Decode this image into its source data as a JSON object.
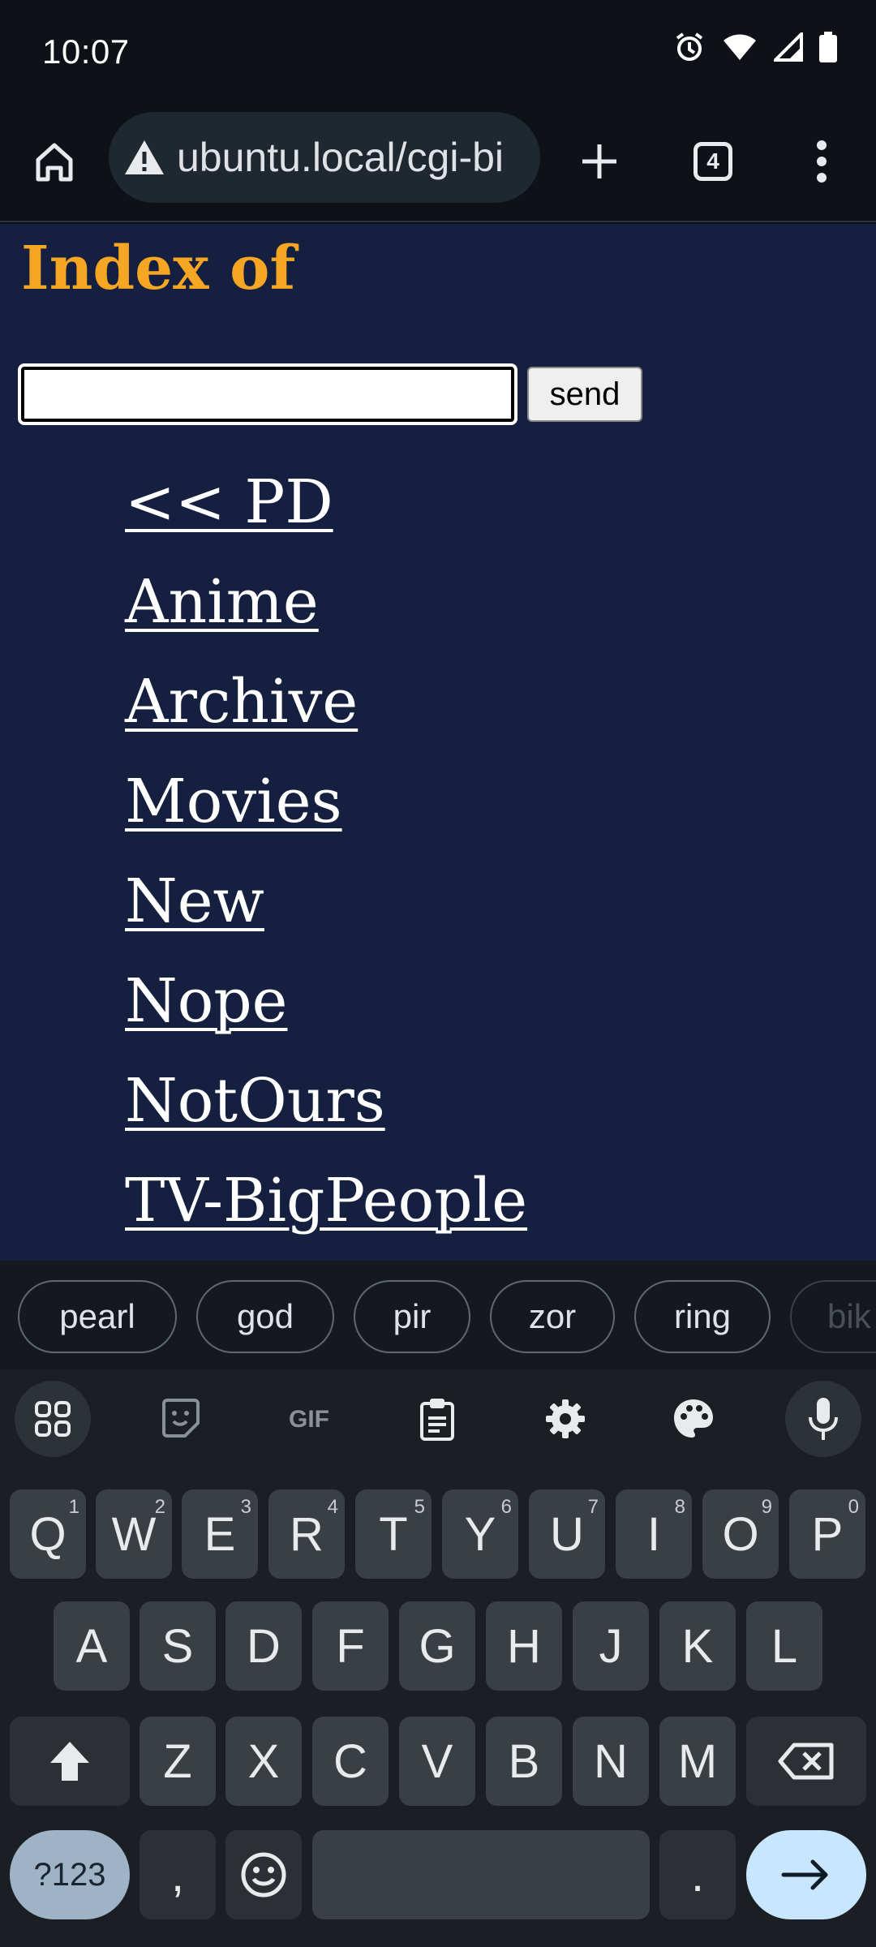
{
  "status_bar": {
    "time": "10:07"
  },
  "browser": {
    "url": "ubuntu.local/cgi-bi",
    "tab_count": "4"
  },
  "page": {
    "heading": "Index of",
    "search_value": "",
    "send_label": "send",
    "links": [
      "<< PD",
      "Anime",
      "Archive",
      "Movies",
      "New",
      "Nope",
      "NotOurs",
      "TV-BigPeople"
    ]
  },
  "keyboard": {
    "suggestions": [
      "pearl",
      "god",
      "pir",
      "zor",
      "ring",
      "bik"
    ],
    "row1": [
      {
        "k": "Q",
        "n": "1"
      },
      {
        "k": "W",
        "n": "2"
      },
      {
        "k": "E",
        "n": "3"
      },
      {
        "k": "R",
        "n": "4"
      },
      {
        "k": "T",
        "n": "5"
      },
      {
        "k": "Y",
        "n": "6"
      },
      {
        "k": "U",
        "n": "7"
      },
      {
        "k": "I",
        "n": "8"
      },
      {
        "k": "O",
        "n": "9"
      },
      {
        "k": "P",
        "n": "0"
      }
    ],
    "row2": [
      "A",
      "S",
      "D",
      "F",
      "G",
      "H",
      "J",
      "K",
      "L"
    ],
    "row3": [
      "Z",
      "X",
      "C",
      "V",
      "B",
      "N",
      "M"
    ],
    "symbols_label": "?123",
    "comma": ",",
    "period": "."
  }
}
